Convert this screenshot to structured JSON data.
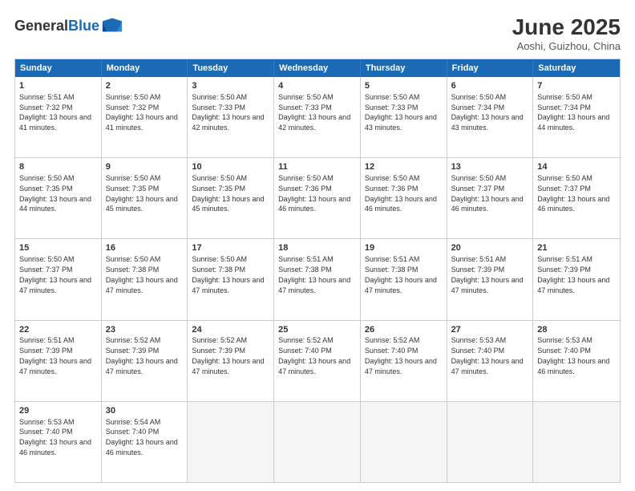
{
  "logo": {
    "general": "General",
    "blue": "Blue"
  },
  "title": "June 2025",
  "location": "Aoshi, Guizhou, China",
  "header": {
    "days": [
      "Sunday",
      "Monday",
      "Tuesday",
      "Wednesday",
      "Thursday",
      "Friday",
      "Saturday"
    ]
  },
  "rows": [
    {
      "cells": [
        {
          "day": "1",
          "info": "Sunrise: 5:51 AM\nSunset: 7:32 PM\nDaylight: 13 hours and 41 minutes.",
          "empty": false
        },
        {
          "day": "2",
          "info": "Sunrise: 5:50 AM\nSunset: 7:32 PM\nDaylight: 13 hours and 41 minutes.",
          "empty": false
        },
        {
          "day": "3",
          "info": "Sunrise: 5:50 AM\nSunset: 7:33 PM\nDaylight: 13 hours and 42 minutes.",
          "empty": false
        },
        {
          "day": "4",
          "info": "Sunrise: 5:50 AM\nSunset: 7:33 PM\nDaylight: 13 hours and 42 minutes.",
          "empty": false
        },
        {
          "day": "5",
          "info": "Sunrise: 5:50 AM\nSunset: 7:33 PM\nDaylight: 13 hours and 43 minutes.",
          "empty": false
        },
        {
          "day": "6",
          "info": "Sunrise: 5:50 AM\nSunset: 7:34 PM\nDaylight: 13 hours and 43 minutes.",
          "empty": false
        },
        {
          "day": "7",
          "info": "Sunrise: 5:50 AM\nSunset: 7:34 PM\nDaylight: 13 hours and 44 minutes.",
          "empty": false
        }
      ]
    },
    {
      "cells": [
        {
          "day": "8",
          "info": "Sunrise: 5:50 AM\nSunset: 7:35 PM\nDaylight: 13 hours and 44 minutes.",
          "empty": false
        },
        {
          "day": "9",
          "info": "Sunrise: 5:50 AM\nSunset: 7:35 PM\nDaylight: 13 hours and 45 minutes.",
          "empty": false
        },
        {
          "day": "10",
          "info": "Sunrise: 5:50 AM\nSunset: 7:35 PM\nDaylight: 13 hours and 45 minutes.",
          "empty": false
        },
        {
          "day": "11",
          "info": "Sunrise: 5:50 AM\nSunset: 7:36 PM\nDaylight: 13 hours and 46 minutes.",
          "empty": false
        },
        {
          "day": "12",
          "info": "Sunrise: 5:50 AM\nSunset: 7:36 PM\nDaylight: 13 hours and 46 minutes.",
          "empty": false
        },
        {
          "day": "13",
          "info": "Sunrise: 5:50 AM\nSunset: 7:37 PM\nDaylight: 13 hours and 46 minutes.",
          "empty": false
        },
        {
          "day": "14",
          "info": "Sunrise: 5:50 AM\nSunset: 7:37 PM\nDaylight: 13 hours and 46 minutes.",
          "empty": false
        }
      ]
    },
    {
      "cells": [
        {
          "day": "15",
          "info": "Sunrise: 5:50 AM\nSunset: 7:37 PM\nDaylight: 13 hours and 47 minutes.",
          "empty": false
        },
        {
          "day": "16",
          "info": "Sunrise: 5:50 AM\nSunset: 7:38 PM\nDaylight: 13 hours and 47 minutes.",
          "empty": false
        },
        {
          "day": "17",
          "info": "Sunrise: 5:50 AM\nSunset: 7:38 PM\nDaylight: 13 hours and 47 minutes.",
          "empty": false
        },
        {
          "day": "18",
          "info": "Sunrise: 5:51 AM\nSunset: 7:38 PM\nDaylight: 13 hours and 47 minutes.",
          "empty": false
        },
        {
          "day": "19",
          "info": "Sunrise: 5:51 AM\nSunset: 7:38 PM\nDaylight: 13 hours and 47 minutes.",
          "empty": false
        },
        {
          "day": "20",
          "info": "Sunrise: 5:51 AM\nSunset: 7:39 PM\nDaylight: 13 hours and 47 minutes.",
          "empty": false
        },
        {
          "day": "21",
          "info": "Sunrise: 5:51 AM\nSunset: 7:39 PM\nDaylight: 13 hours and 47 minutes.",
          "empty": false
        }
      ]
    },
    {
      "cells": [
        {
          "day": "22",
          "info": "Sunrise: 5:51 AM\nSunset: 7:39 PM\nDaylight: 13 hours and 47 minutes.",
          "empty": false
        },
        {
          "day": "23",
          "info": "Sunrise: 5:52 AM\nSunset: 7:39 PM\nDaylight: 13 hours and 47 minutes.",
          "empty": false
        },
        {
          "day": "24",
          "info": "Sunrise: 5:52 AM\nSunset: 7:39 PM\nDaylight: 13 hours and 47 minutes.",
          "empty": false
        },
        {
          "day": "25",
          "info": "Sunrise: 5:52 AM\nSunset: 7:40 PM\nDaylight: 13 hours and 47 minutes.",
          "empty": false
        },
        {
          "day": "26",
          "info": "Sunrise: 5:52 AM\nSunset: 7:40 PM\nDaylight: 13 hours and 47 minutes.",
          "empty": false
        },
        {
          "day": "27",
          "info": "Sunrise: 5:53 AM\nSunset: 7:40 PM\nDaylight: 13 hours and 47 minutes.",
          "empty": false
        },
        {
          "day": "28",
          "info": "Sunrise: 5:53 AM\nSunset: 7:40 PM\nDaylight: 13 hours and 46 minutes.",
          "empty": false
        }
      ]
    },
    {
      "cells": [
        {
          "day": "29",
          "info": "Sunrise: 5:53 AM\nSunset: 7:40 PM\nDaylight: 13 hours and 46 minutes.",
          "empty": false
        },
        {
          "day": "30",
          "info": "Sunrise: 5:54 AM\nSunset: 7:40 PM\nDaylight: 13 hours and 46 minutes.",
          "empty": false
        },
        {
          "day": "",
          "info": "",
          "empty": true
        },
        {
          "day": "",
          "info": "",
          "empty": true
        },
        {
          "day": "",
          "info": "",
          "empty": true
        },
        {
          "day": "",
          "info": "",
          "empty": true
        },
        {
          "day": "",
          "info": "",
          "empty": true
        }
      ]
    }
  ]
}
